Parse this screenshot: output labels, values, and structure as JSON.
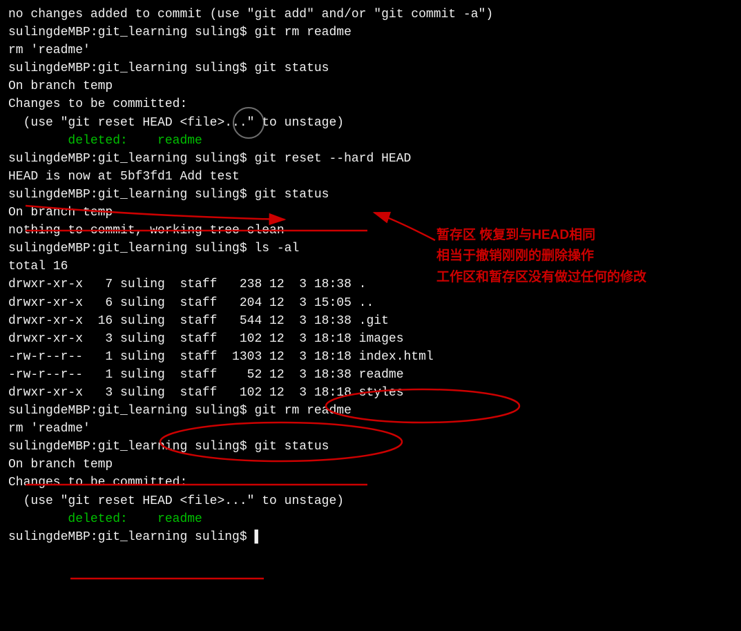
{
  "terminal": {
    "lines": [
      {
        "type": "white",
        "text": "no changes added to commit (use \"git add\" and/or \"git commit -a\")"
      },
      {
        "type": "white",
        "text": "sulingdeMBP:git_learning suling$ git rm readme"
      },
      {
        "type": "white",
        "text": "rm 'readme'"
      },
      {
        "type": "white",
        "text": "sulingdeMBP:git_learning suling$ git status"
      },
      {
        "type": "white",
        "text": "On branch temp"
      },
      {
        "type": "white",
        "text": "Changes to be committed:"
      },
      {
        "type": "white",
        "text": "  (use \"git reset HEAD <file>...\" to unstage)"
      },
      {
        "type": "empty",
        "text": ""
      },
      {
        "type": "green",
        "text": "\tdeleted:    readme"
      },
      {
        "type": "empty",
        "text": ""
      },
      {
        "type": "empty",
        "text": ""
      },
      {
        "type": "white",
        "text": "sulingdeMBP:git_learning suling$ git reset --hard HEAD"
      },
      {
        "type": "white",
        "text": "HEAD is now at 5bf3fd1 Add test"
      },
      {
        "type": "white",
        "text": "sulingdeMBP:git_learning suling$ git status"
      },
      {
        "type": "white",
        "text": "On branch temp"
      },
      {
        "type": "white",
        "text": "nothing to commit, working tree clean"
      },
      {
        "type": "white",
        "text": "sulingdeMBP:git_learning suling$ ls -al"
      },
      {
        "type": "white",
        "text": "total 16"
      },
      {
        "type": "white",
        "text": "drwxr-xr-x   7 suling  staff   238 12  3 18:38 ."
      },
      {
        "type": "white",
        "text": "drwxr-xr-x   6 suling  staff   204 12  3 15:05 .."
      },
      {
        "type": "white",
        "text": "drwxr-xr-x  16 suling  staff   544 12  3 18:38 .git"
      },
      {
        "type": "white",
        "text": "drwxr-xr-x   3 suling  staff   102 12  3 18:18 images"
      },
      {
        "type": "white",
        "text": "-rw-r--r--   1 suling  staff  1303 12  3 18:18 index.html"
      },
      {
        "type": "white",
        "text": "-rw-r--r--   1 suling  staff    52 12  3 18:38 readme"
      },
      {
        "type": "white",
        "text": "drwxr-xr-x   3 suling  staff   102 12  3 18:18 styles"
      },
      {
        "type": "white",
        "text": "sulingdeMBP:git_learning suling$ git rm readme"
      },
      {
        "type": "white",
        "text": "rm 'readme'"
      },
      {
        "type": "white",
        "text": "sulingdeMBP:git_learning suling$ git status"
      },
      {
        "type": "white",
        "text": "On branch temp"
      },
      {
        "type": "white",
        "text": "Changes to be committed:"
      },
      {
        "type": "white",
        "text": "  (use \"git reset HEAD <file>...\" to unstage)"
      },
      {
        "type": "empty",
        "text": ""
      },
      {
        "type": "green",
        "text": "\tdeleted:    readme"
      },
      {
        "type": "empty",
        "text": ""
      },
      {
        "type": "white",
        "text": "sulingdeMBP:git_learning suling$ ▌"
      }
    ],
    "annotation": {
      "text1": "暂存区 恢复到与HEAD相同",
      "text2": "相当于撤销刚刚的删除操作",
      "text3": "工作区和暂存区没有做过任何的修改"
    }
  }
}
